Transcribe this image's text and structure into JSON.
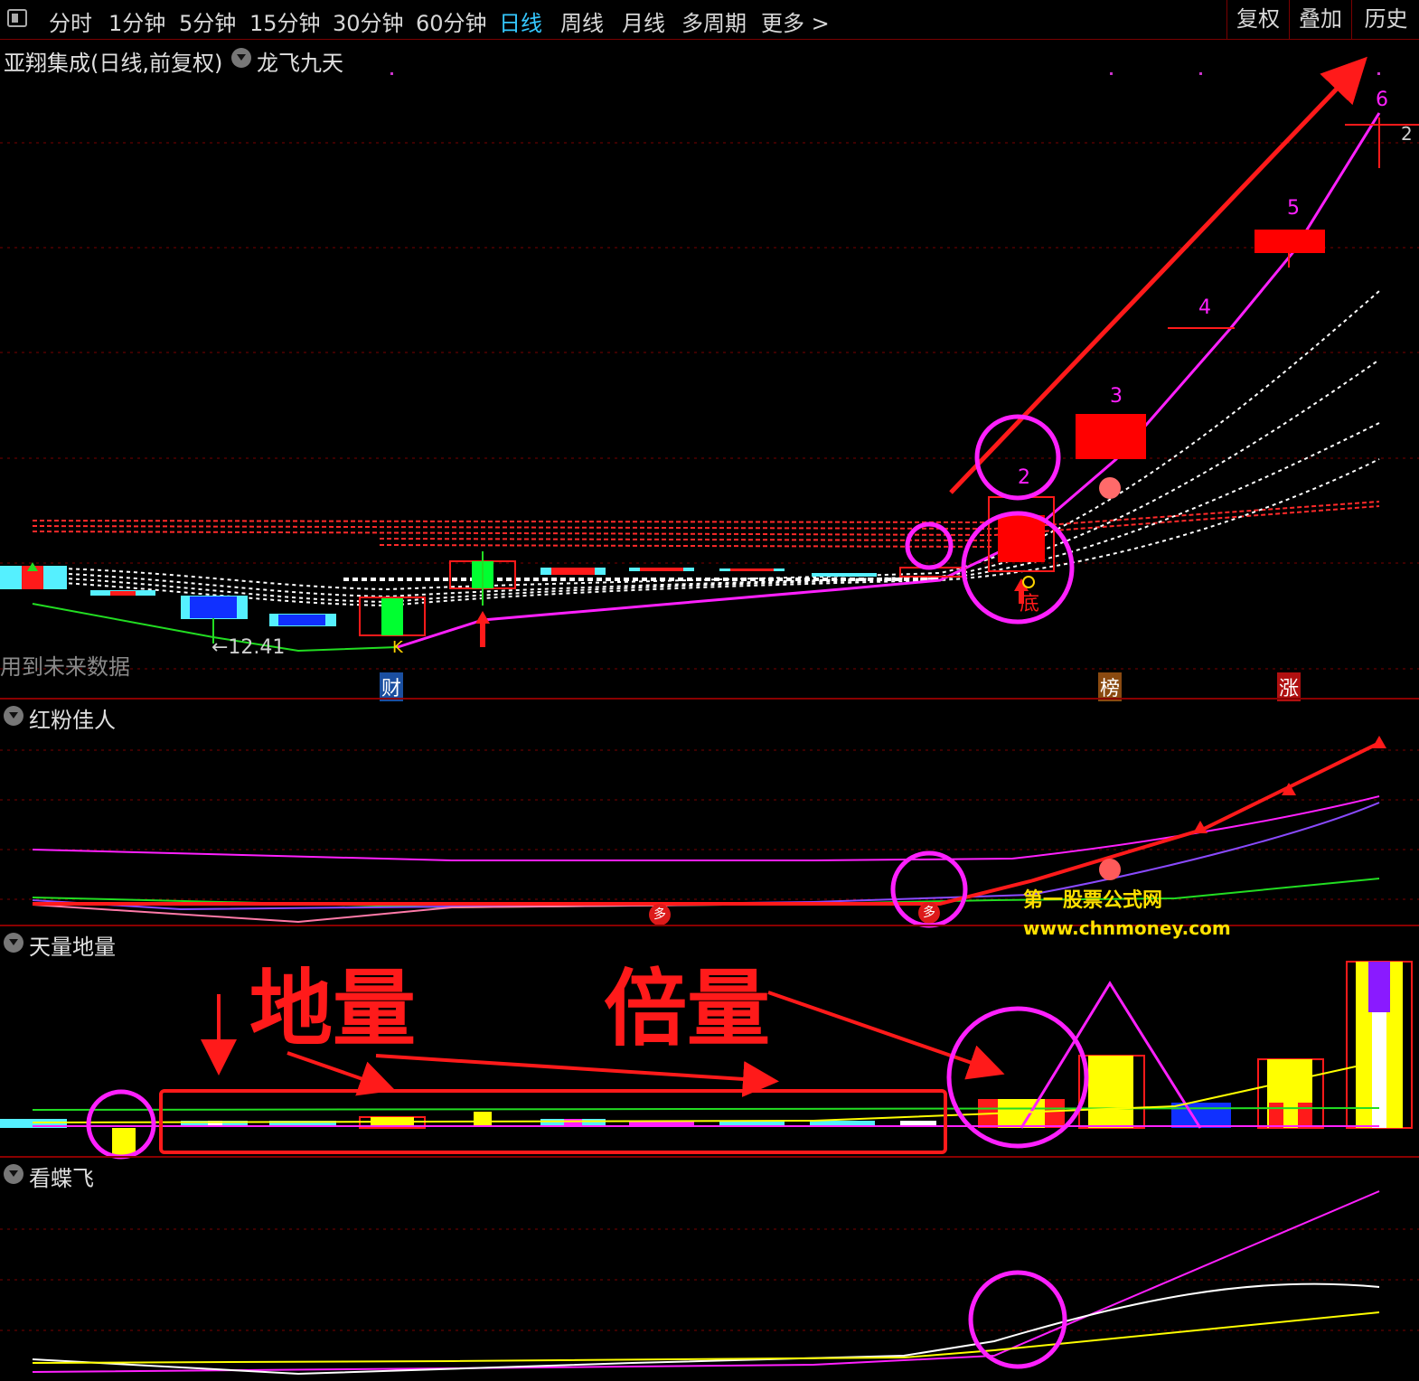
{
  "toolbar": {
    "periods": [
      "分时",
      "1分钟",
      "5分钟",
      "15分钟",
      "30分钟",
      "60分钟",
      "日线",
      "周线",
      "月线",
      "多周期",
      "更多 >"
    ],
    "active": "日线",
    "right_buttons": [
      "复权",
      "叠加",
      "历史"
    ]
  },
  "main_panel": {
    "title": "亚翔集成(日线,前复权)",
    "indicator": "龙飞九天",
    "note": "用到未来数据",
    "low_label": "←12.41",
    "wave_labels": [
      "2",
      "3",
      "4",
      "5",
      "6"
    ],
    "corner_label": "2",
    "k_label": "K",
    "di_label": "底",
    "event_tags": [
      {
        "text": "财",
        "color": "#1a4fa0"
      },
      {
        "text": "榜",
        "color": "#8a4a10"
      },
      {
        "text": "涨",
        "color": "#b01010"
      }
    ]
  },
  "panel2": {
    "title": "红粉佳人",
    "duo_label": "多"
  },
  "panel3": {
    "title": "天量地量",
    "annot_left": "地量",
    "annot_right": "倍量"
  },
  "panel4": {
    "title": "看蝶飞"
  },
  "watermark": {
    "line1": "第一股票公式网",
    "line2": "www.chnmoney.com"
  },
  "colors": {
    "up": "#ff0000",
    "down_cyan": "#55f0ff",
    "down_blue": "#1030ff",
    "green": "#00ff30",
    "magenta": "#ff20ff",
    "yellow": "#ffff00",
    "accent": "#35c8ff"
  }
}
